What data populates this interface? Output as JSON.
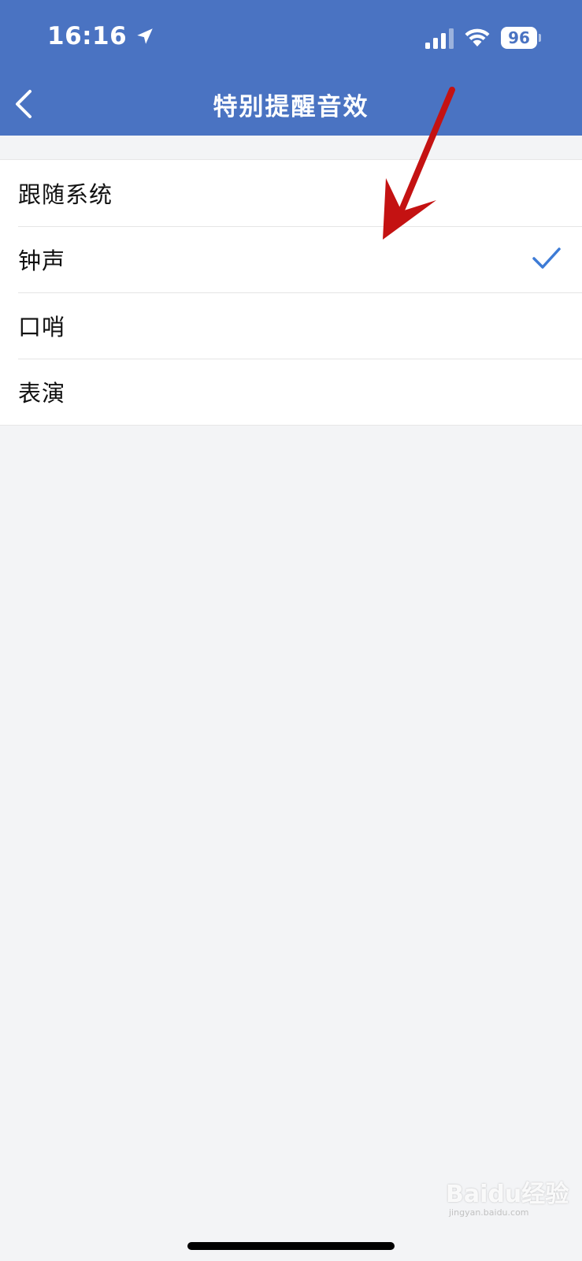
{
  "status_bar": {
    "time": "16:16",
    "battery": "96",
    "location_icon": "location-arrow-icon",
    "signal_icon": "cellular-signal-icon",
    "wifi_icon": "wifi-icon"
  },
  "header": {
    "title": "特别提醒音效",
    "back_icon": "chevron-left-icon",
    "background_color": "#4a73c2"
  },
  "options": [
    {
      "label": "跟随系统",
      "selected": false
    },
    {
      "label": "钟声",
      "selected": true
    },
    {
      "label": "口哨",
      "selected": false
    },
    {
      "label": "表演",
      "selected": false
    }
  ],
  "selection_color": "#3d7bd6",
  "annotation_color": "#c41212",
  "watermark": {
    "brand": "Baidu经验",
    "url": "jingyan.baidu.com"
  }
}
